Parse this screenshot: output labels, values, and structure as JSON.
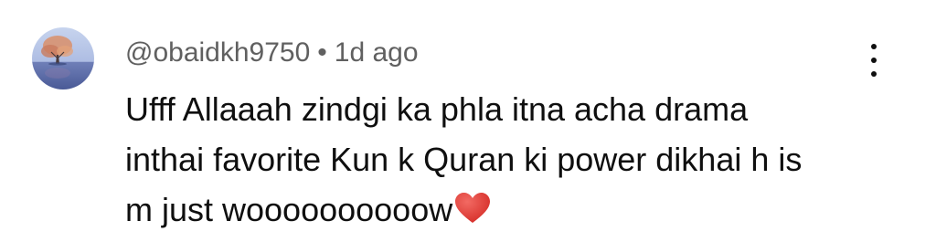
{
  "comment": {
    "author": {
      "handle": "@obaidkh9750",
      "avatar_icon": "tree-lake-avatar-icon"
    },
    "separator": "•",
    "timestamp": "1d ago",
    "text": "Ufff Allaaah zindgi ka phla itna acha drama\ninthai favorite Kun k Quran ki power dikhai h is\nm just woooooooooow",
    "emoji": "heart-icon",
    "menu_icon": "more-vertical-icon"
  },
  "colors": {
    "background": "#ffffff",
    "text_primary": "#0f0f0f",
    "text_secondary": "#606060",
    "heart": "#e0312b"
  }
}
